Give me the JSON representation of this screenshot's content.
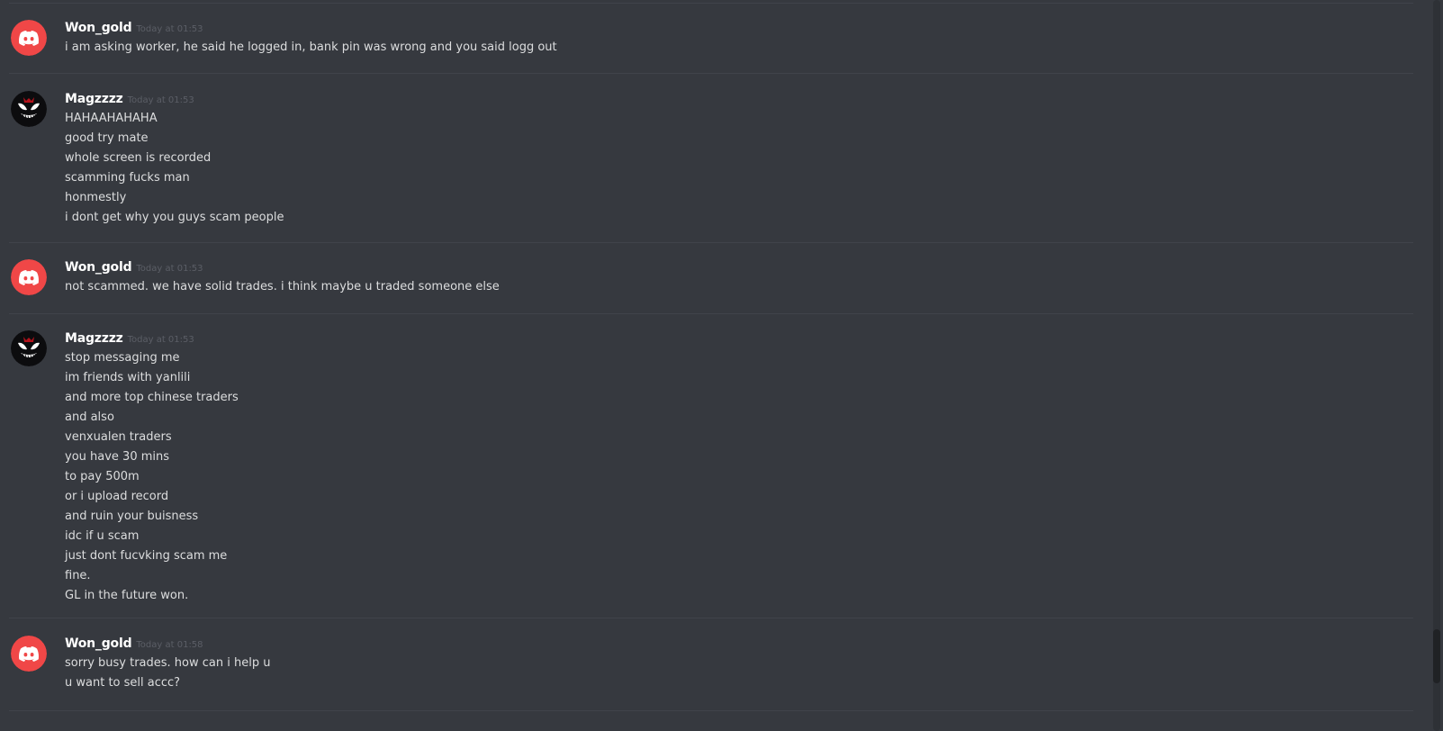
{
  "colors": {
    "background": "#36393f",
    "username": "#ffffff",
    "timestamp": "#5b5e66",
    "message_text": "#dcddde",
    "discord_avatar": "#f04747",
    "divider": "#40434a"
  },
  "messages": [
    {
      "author": "Won_gold",
      "avatar": "discord-logo-icon",
      "timestamp": "Today at 01:53",
      "lines": [
        "i am asking worker, he said he logged in, bank pin was wrong and you said logg out"
      ]
    },
    {
      "author": "Magzzzz",
      "avatar": "venom-face-icon",
      "timestamp": "Today at 01:53",
      "lines": [
        "HAHAAHAHAHA",
        "good try mate",
        "whole screen is recorded",
        "scamming fucks man",
        "honmestly",
        "i dont get why you guys scam people"
      ]
    },
    {
      "author": "Won_gold",
      "avatar": "discord-logo-icon",
      "timestamp": "Today at 01:53",
      "lines": [
        "not scammed. we have solid trades. i think maybe u traded someone else"
      ]
    },
    {
      "author": "Magzzzz",
      "avatar": "venom-face-icon",
      "timestamp": "Today at 01:53",
      "lines": [
        "stop messaging me",
        "im friends with yanlili",
        "and more top chinese traders",
        "and also",
        "venxualen traders",
        "you have 30 mins",
        "to pay 500m",
        "or i upload record",
        "and ruin your buisness",
        "idc if u scam",
        "just dont fucvking scam me",
        "fine.",
        "GL in the future won."
      ]
    },
    {
      "author": "Won_gold",
      "avatar": "discord-logo-icon",
      "timestamp": "Today at 01:58",
      "lines": [
        "sorry busy trades. how can i help u",
        "u want to sell accc?"
      ]
    }
  ],
  "scrollbar": {
    "position": 0.93
  }
}
